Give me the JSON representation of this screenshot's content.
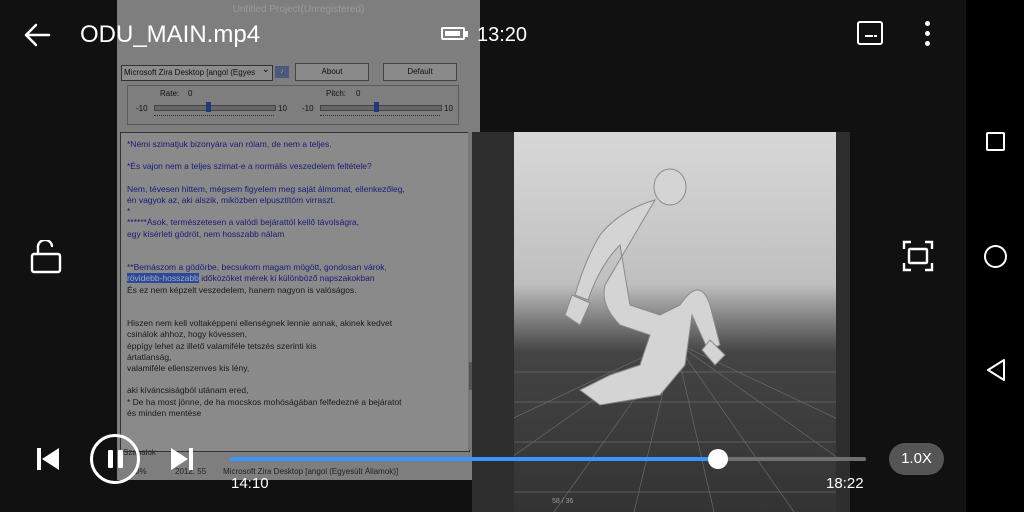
{
  "player": {
    "file_name": "ODU_MAIN.mp4",
    "clock": "13:20",
    "current_time": "14:10",
    "total_time": "18:22",
    "progress": 0.767,
    "speed_label": "1.0X",
    "accent_color": "#3b95ff"
  },
  "icons": {
    "back": "arrow-left-icon",
    "battery": "battery-icon",
    "subtitles": "subtitles-icon",
    "more": "more-vertical-icon",
    "lock": "unlock-icon",
    "crop": "screen-fit-icon",
    "prev": "skip-previous-icon",
    "pause": "pause-icon",
    "next": "skip-next-icon",
    "nav_recents": "recents-square-icon",
    "nav_home": "home-circle-icon",
    "nav_back": "nav-back-triangle-icon"
  },
  "video_content": {
    "app_title": "Untitled Project(Unregistered)",
    "voice_select": "Microsoft Zira Desktop [angol (Egyes",
    "about_btn": "About",
    "default_btn": "Default",
    "rate_label": "Rate:",
    "rate_value": "0",
    "pitch_label": "Pitch:",
    "pitch_value": "0",
    "min_label": "-10",
    "max_label": "10",
    "lines": [
      "*Némi szimatjuk bizonyára van rólam, de nem a teljes.",
      "",
      "*És vajon nem a teljes szimat-e a normális veszedelem feltétele?",
      "",
      "Nem, tévesen hittem, mégsem figyelem meg saját álmomat, ellenkezőleg,",
      "én vagyok az, aki alszik, miközben elpusztítóm virraszt.",
      "*",
      "******Ások, természetesen a valódi bejárattól kellő távolságra,",
      "egy kísérleti gödröt, nem hosszabb nálam",
      "",
      "",
      "**Bemászom a gödörbe, becsukom magam mögött, gondosan várok,",
      "rövidebb-hosszabb időközöket mérek ki különböző napszakokban",
      "És ez nem képzelt veszedelem, hanem nagyon is valóságos.",
      "",
      "",
      "Hiszen nem kell voltaképpeni ellenségnek lennie annak, akinek kedvet",
      "csinálok ahhoz, hogy kövessen,",
      "éppígy lehet az illető valamiféle tetszés szerinti kis",
      "ártatlanság,",
      "valamiféle ellenszenves kis lény,",
      "",
      "aki kíváncsiságból utánam ered,",
      "* De ha most jönne, de ha mocskos mohóságában felfedezné a bejáratot",
      "és minden mentése"
    ],
    "line_six_highlight": "rövidebb-hosszabb",
    "line_six_rest": " időközöket mérek ki különböző napszakokban",
    "status_left": "Szabalok",
    "status_pct": "0%",
    "status_num": "2012. 55",
    "status_voice": "Microsoft Zira Desktop [angol (Egyesült Államok)]",
    "vp_frame": "58 / 36"
  }
}
